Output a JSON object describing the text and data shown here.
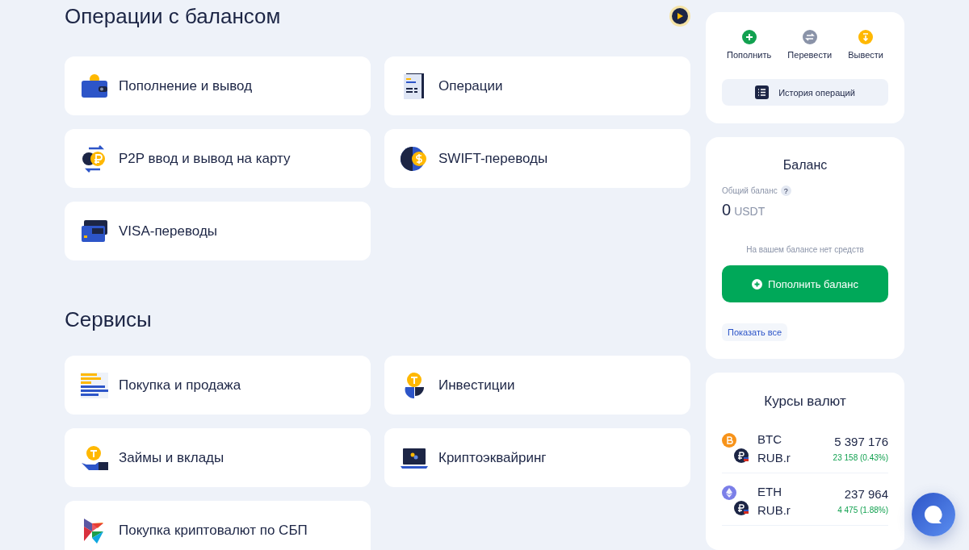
{
  "sections": [
    {
      "title": "Операции с балансом",
      "items": [
        {
          "label": "Пополнение и вывод",
          "kind": "wallet"
        },
        {
          "label": "Операции",
          "kind": "document"
        },
        {
          "label": "P2P ввод и вывод на карту",
          "kind": "p2p"
        },
        {
          "label": "SWIFT-переводы",
          "kind": "globe"
        },
        {
          "label": "VISA-переводы",
          "kind": "card"
        }
      ]
    },
    {
      "title": "Сервисы",
      "items": [
        {
          "label": "Покупка и продажа",
          "kind": "bars"
        },
        {
          "label": "Инвестиции",
          "kind": "invest"
        },
        {
          "label": "Займы и вклады",
          "kind": "hand"
        },
        {
          "label": "Криптоэквайринг",
          "kind": "laptop"
        },
        {
          "label": "Покупка криптовалют по СБП",
          "kind": "sbp"
        }
      ]
    }
  ],
  "quick_actions": [
    {
      "label": "Пополнить",
      "kind": "plus",
      "color": "#12a150"
    },
    {
      "label": "Перевести",
      "kind": "swap",
      "color": "#8a93a8"
    },
    {
      "label": "Вывести",
      "kind": "down",
      "color": "#ffb800"
    }
  ],
  "history_button": "История операций",
  "balance": {
    "title": "Баланс",
    "total_label": "Общий баланс",
    "help": "?",
    "amount": "0",
    "currency": "USDT",
    "empty_note": "На вашем балансе нет средств",
    "topup_button": "Пополнить баланс",
    "show_all": "Показать все"
  },
  "rates": {
    "title": "Курсы валют",
    "rows": [
      {
        "base": "BTC",
        "quote": "RUB.r",
        "price": "5 397 176",
        "change": "23 158 (0.43%)",
        "kind": "btc"
      },
      {
        "base": "ETH",
        "quote": "RUB.r",
        "price": "237 964",
        "change": "4 475 (1.88%)",
        "kind": "eth"
      }
    ]
  }
}
